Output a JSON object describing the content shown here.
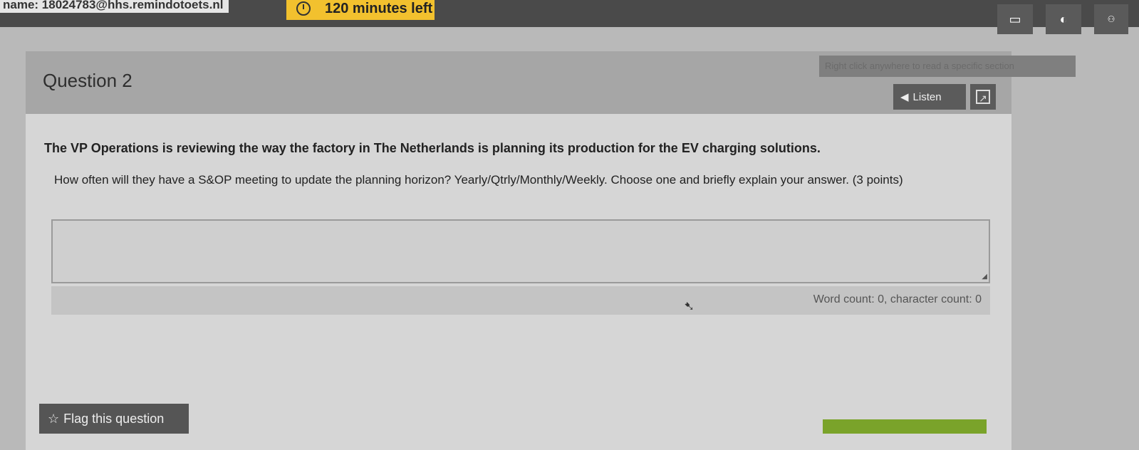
{
  "header": {
    "user_email": "name: 18024783@hhs.remindotoets.nl",
    "timer_text": "120 minutes left",
    "icons": [
      "monitor-icon",
      "contrast-icon",
      "user-icon"
    ]
  },
  "question": {
    "title": "Question 2",
    "tooltip": "Right click anywhere to read a specific section",
    "listen_label": "Listen",
    "context": "The VP Operations is reviewing the way the factory in The Netherlands is planning its production for the EV charging solutions.",
    "prompt": "How often will they have a S&OP meeting to update the planning horizon? Yearly/Qtrly/Monthly/Weekly. Choose one and briefly explain your answer. (3 points)",
    "answer_value": "",
    "counter": "Word count: 0, character count: 0"
  },
  "footer": {
    "flag_label": "Flag this question",
    "flag_icon": "star-icon"
  },
  "colors": {
    "timer": "#f2c12e",
    "header_bar": "#4a4a4a",
    "next_button": "#7aa32a"
  }
}
